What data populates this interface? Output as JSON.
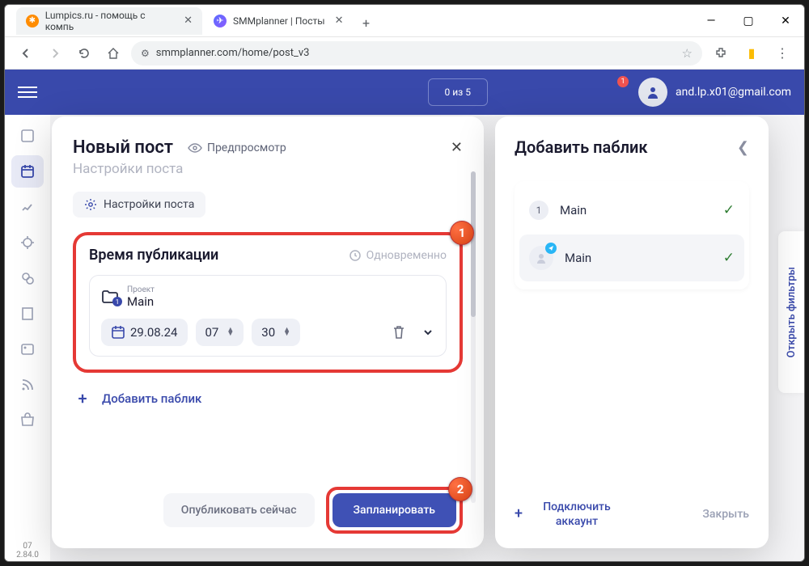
{
  "browser": {
    "tabs": [
      {
        "title": "Lumpics.ru - помощь с компь"
      },
      {
        "title": "SMMplanner | Посты"
      }
    ],
    "url": "smmplanner.com/home/post_v3"
  },
  "header": {
    "counter": "0 из 5",
    "notif_count": "1",
    "email": "and.lp.x01@gmail.com"
  },
  "sidebar": {
    "version_line1": "07",
    "version_line2": "2.84.0"
  },
  "filters_label": "Открыть фильтры",
  "dialog1": {
    "title": "Новый пост",
    "preview": "Предпросмотр",
    "subtitle": "Настройки поста",
    "settings_chip": "Настройки поста",
    "section_title": "Время публикации",
    "simult": "Одновременно",
    "project_label": "Проект",
    "project_name": "Main",
    "date": "29.08.24",
    "hour": "07",
    "minute": "30",
    "add_public": "Добавить паблик",
    "publish_now": "Опубликовать сейчас",
    "plan": "Запланировать",
    "badge1": "1",
    "badge2": "2"
  },
  "dialog2": {
    "title": "Добавить паблик",
    "row1_num": "1",
    "row1_name": "Main",
    "row2_name": "Main",
    "connect": "Подключить аккаунт",
    "close": "Закрыть"
  }
}
